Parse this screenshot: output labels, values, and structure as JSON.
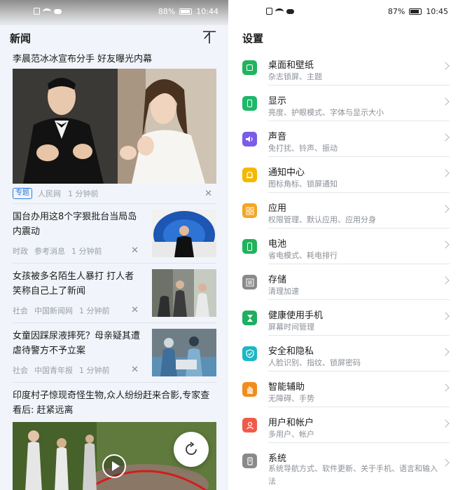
{
  "left_status": {
    "battery": "88%",
    "time": "10:44"
  },
  "right_status": {
    "battery": "87%",
    "time": "10:45"
  },
  "news": {
    "header_title": "新闻",
    "hero": {
      "title": "李晨范冰冰宣布分手 好友曝光内幕",
      "tag": "专题",
      "source": "人民网",
      "time": "1 分钟前"
    },
    "items": [
      {
        "title": "国台办用这8个字狠批台当局岛内震动",
        "category": "时政",
        "source": "参考消息",
        "time": "1 分钟前"
      },
      {
        "title": "女孩被多名陌生人暴打 打人者笑称自己上了新闻",
        "category": "社会",
        "source": "中国新闻网",
        "time": "1 分钟前"
      },
      {
        "title": "女童因踩尿液摔死？母亲疑其遭虐待警方不予立案",
        "category": "社会",
        "source": "中国青年报",
        "time": "1 分钟前"
      }
    ],
    "last_title": "印度村子惊现奇怪生物,众人纷纷赶来合影,专家查看后: 赶紧远离"
  },
  "settings": {
    "title": "设置",
    "items": [
      {
        "label": "桌面和壁纸",
        "sub": "杂志锁屏、主题",
        "color": "#20b45e",
        "icon": "wallpaper-icon"
      },
      {
        "label": "显示",
        "sub": "亮度、护眼模式、字体与显示大小",
        "color": "#1fb76a",
        "icon": "display-icon"
      },
      {
        "label": "声音",
        "sub": "免打扰、铃声、振动",
        "color": "#7a5ce6",
        "icon": "sound-icon"
      },
      {
        "label": "通知中心",
        "sub": "图标角标、锁屏通知",
        "color": "#f5b800",
        "icon": "bell-icon"
      },
      {
        "label": "应用",
        "sub": "权限管理、默认应用、应用分身",
        "color": "#f5a623",
        "icon": "apps-icon"
      },
      {
        "label": "电池",
        "sub": "省电模式、耗电排行",
        "color": "#21b25c",
        "icon": "battery-icon"
      },
      {
        "label": "存储",
        "sub": "清理加速",
        "color": "#8a8a8a",
        "icon": "storage-icon"
      },
      {
        "label": "健康使用手机",
        "sub": "屏幕时间管理",
        "color": "#1fae62",
        "icon": "hourglass-icon"
      },
      {
        "label": "安全和隐私",
        "sub": "人脸识别、指纹、锁屏密码",
        "color": "#19b8c4",
        "icon": "shield-icon"
      },
      {
        "label": "智能辅助",
        "sub": "无障碍、手势",
        "color": "#f28c1c",
        "icon": "hand-icon"
      },
      {
        "label": "用户和帐户",
        "sub": "多用户、帐户",
        "color": "#f05a4a",
        "icon": "user-icon"
      },
      {
        "label": "系统",
        "sub": "系统导航方式、软件更新、关于手机、语言和输入法",
        "color": "#8a8a8a",
        "icon": "system-icon"
      }
    ]
  }
}
